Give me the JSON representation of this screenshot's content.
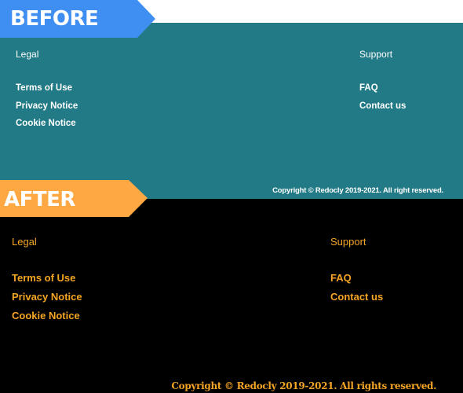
{
  "colors": {
    "before_bg": "#227a86",
    "before_text": "#ffffff",
    "after_bg": "#000000",
    "after_text": "#f5a524",
    "before_tag": "#3f8ff2",
    "after_tag": "#fea844"
  },
  "tags": {
    "before": "BEFORE",
    "after": "AFTER"
  },
  "before": {
    "legal": {
      "title": "Legal",
      "links": [
        "Terms of Use",
        "Privacy Notice",
        "Cookie Notice"
      ]
    },
    "support": {
      "title": "Support",
      "links": [
        "FAQ",
        "Contact us"
      ]
    },
    "copyright": "Copyright © Redocly 2019-2021. All right reserved."
  },
  "after": {
    "legal": {
      "title": "Legal",
      "links": [
        "Terms of Use",
        "Privacy Notice",
        "Cookie Notice"
      ]
    },
    "support": {
      "title": "Support",
      "links": [
        "FAQ",
        "Contact us"
      ]
    },
    "copyright": "Copyright © Redocly 2019-2021. All rights reserved."
  }
}
